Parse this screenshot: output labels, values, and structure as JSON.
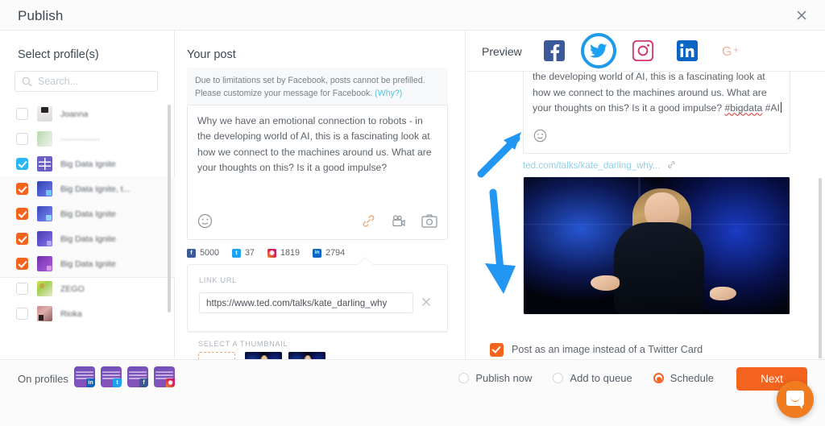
{
  "window": {
    "title": "Publish",
    "close_icon": "close-icon"
  },
  "left_panel": {
    "heading": "Select profile(s)",
    "search": {
      "placeholder": "Search...",
      "value": "",
      "icon": "search-icon"
    },
    "profiles": [
      {
        "name": "Joanna",
        "checked": false,
        "check_color": "",
        "avatar": "av-joanna",
        "grouped": false
      },
      {
        "name": "··············",
        "checked": false,
        "check_color": "",
        "avatar": "av-green",
        "grouped": false
      },
      {
        "name": "Big Data Ignite",
        "checked": true,
        "check_color": "#29b6f6",
        "avatar": "av-grid",
        "grouped": false
      },
      {
        "name": "Big Data Ignite, t...",
        "checked": true,
        "check_color": "#f4641e",
        "avatar": "av-soc1",
        "grouped": true
      },
      {
        "name": "Big Data Ignite",
        "checked": true,
        "check_color": "#f4641e",
        "avatar": "av-soc2",
        "grouped": true
      },
      {
        "name": "Big Data Ignite",
        "checked": true,
        "check_color": "#f4641e",
        "avatar": "av-soc3",
        "grouped": true
      },
      {
        "name": "Big Data Ignite",
        "checked": true,
        "check_color": "#f4641e",
        "avatar": "av-soc4",
        "grouped": true
      },
      {
        "name": "ZEGO",
        "checked": false,
        "check_color": "",
        "avatar": "av-zigo",
        "grouped": false
      },
      {
        "name": "Rioka",
        "checked": false,
        "check_color": "",
        "avatar": "av-rioka",
        "grouped": false
      }
    ]
  },
  "mid_panel": {
    "heading": "Your post",
    "notice": "Due to limitations set by Facebook, posts cannot be prefilled. Please customize your message for Facebook.",
    "notice_link": "(Why?)",
    "compose_value": "Why we have an emotional connection to robots - in the developing world of AI, this is a fascinating look at how we connect to the machines around us. What are your thoughts on  this? Is it a good impulse?",
    "tools": [
      {
        "name": "emoji-icon",
        "label": "emoji"
      },
      {
        "name": "link-icon",
        "label": "link"
      },
      {
        "name": "video-icon",
        "label": "video"
      },
      {
        "name": "photo-icon",
        "label": "photo"
      }
    ],
    "counters": [
      {
        "network": "facebook",
        "badge": "f",
        "count": "5000"
      },
      {
        "network": "twitter",
        "badge": "t",
        "count": "37"
      },
      {
        "network": "instagram",
        "badge": "◎",
        "count": "1819"
      },
      {
        "network": "linkedin",
        "badge": "in",
        "count": "2794"
      }
    ],
    "link_url_label": "LINK URL",
    "link_url_value": "https://www.ted.com/talks/kate_darling_why",
    "thumbnail_label": "SELECT A THUMBNAIL",
    "thumbnails": [
      {
        "type": "add",
        "selected": false
      },
      {
        "type": "image",
        "selected": true
      },
      {
        "type": "image",
        "selected": false
      }
    ]
  },
  "right_panel": {
    "heading": "Preview",
    "networks": [
      {
        "name": "facebook",
        "label": "Facebook",
        "active": false
      },
      {
        "name": "twitter",
        "label": "Twitter",
        "active": true
      },
      {
        "name": "instagram",
        "label": "Instagram",
        "active": false
      },
      {
        "name": "linkedin",
        "label": "LinkedIn",
        "active": false
      },
      {
        "name": "googleplus",
        "label": "Google+",
        "active": false
      }
    ],
    "preview_text_a": "the developing world of AI, this is a fascinating look at how we connect to the machines around us. What are your thoughts on  this? Is it a good impulse? ",
    "preview_hashtag_1": "#bigdata",
    "preview_hashtag_2": "#AI",
    "preview_link": "ted.com/talks/kate_darling_why...",
    "card_option_label": "Post as an image instead of a Twitter Card",
    "card_option_checked": true,
    "annotations": [
      {
        "name": "arrow-up-right",
        "color": "#2196f3"
      },
      {
        "name": "arrow-down",
        "color": "#2196f3"
      }
    ]
  },
  "bottom_bar": {
    "on_profiles_label": "On profiles",
    "avatars": [
      {
        "badge": "in",
        "network": "linkedin"
      },
      {
        "badge": "t",
        "network": "twitter"
      },
      {
        "badge": "f",
        "network": "facebook"
      },
      {
        "badge": "◎",
        "network": "instagram"
      }
    ],
    "options": [
      {
        "label": "Publish now",
        "selected": false
      },
      {
        "label": "Add to queue",
        "selected": false
      },
      {
        "label": "Schedule",
        "selected": true
      }
    ],
    "next_label": "Next",
    "accent_color": "#f4641e",
    "help_widget": "chat-bubble-icon"
  }
}
